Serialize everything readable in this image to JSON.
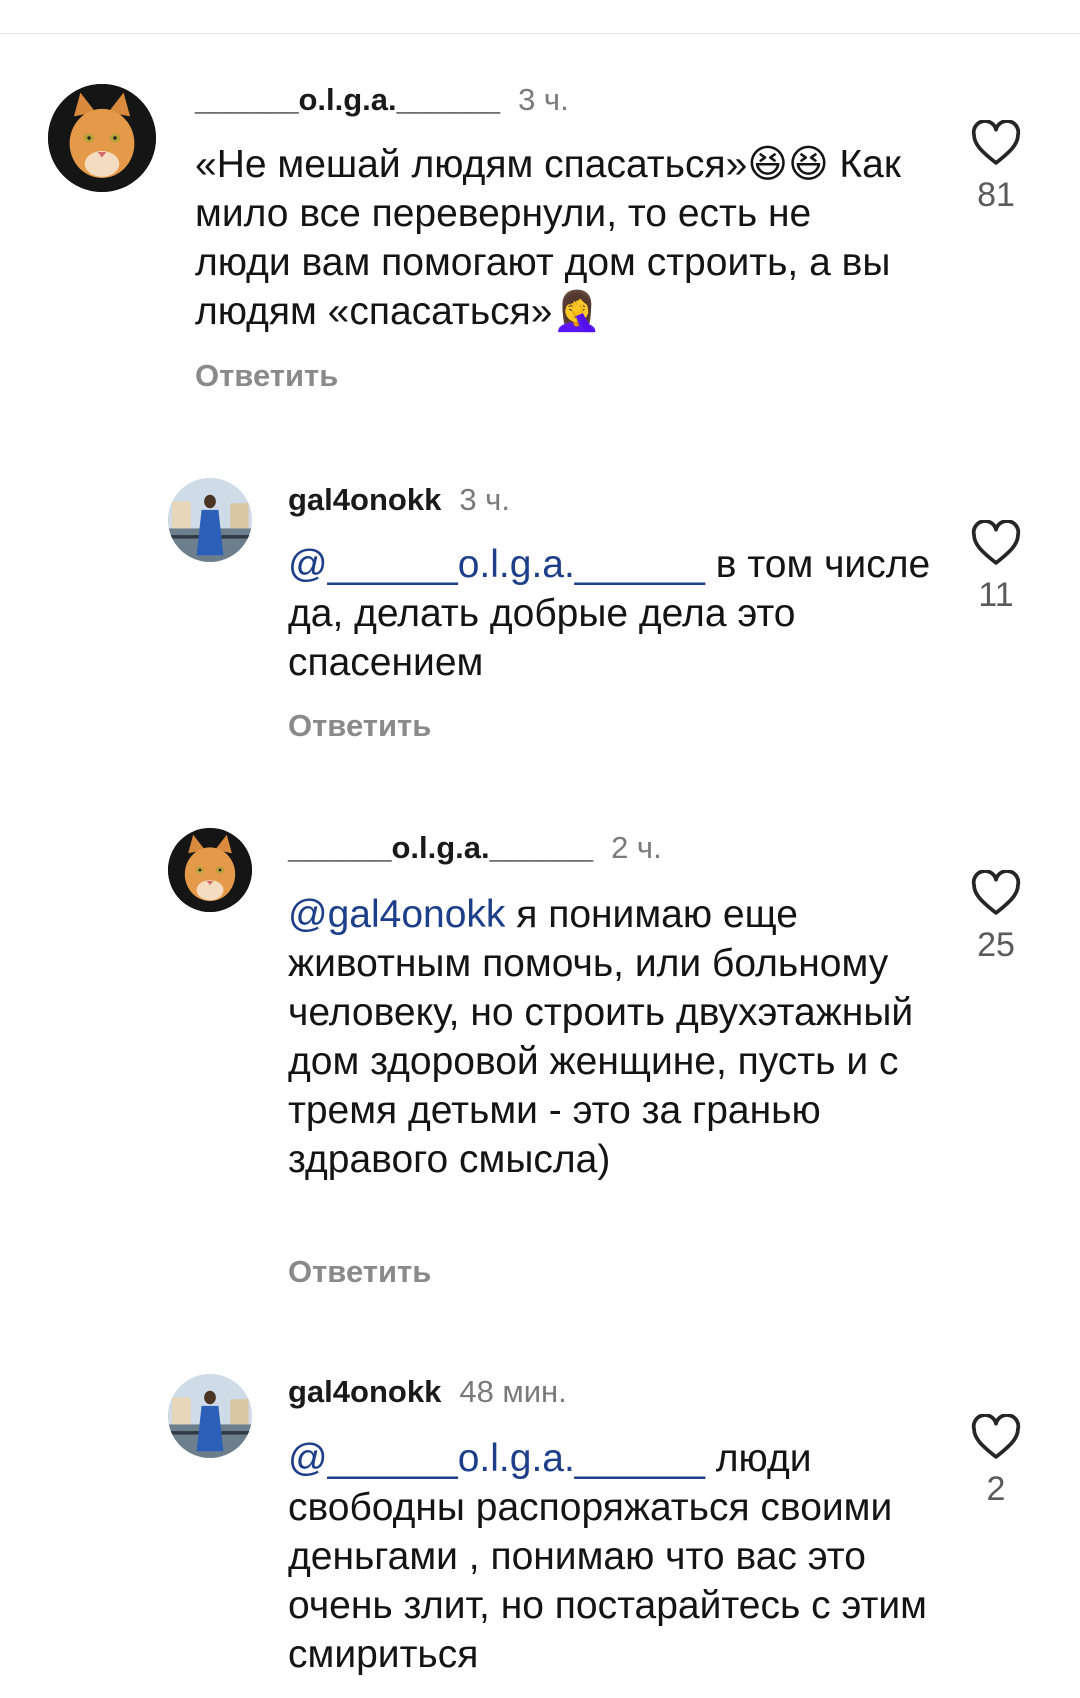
{
  "comments": [
    {
      "username": "______o.l.g.a.______",
      "time": "3 ч.",
      "text": "«Не мешай людям спасаться»😆😆 Как мило все перевернули, то есть не люди вам помогают дом строить, а вы людям «спасаться»🤦‍♀️",
      "reply_label": "Ответить",
      "likes": "81",
      "avatar": "cat-avatar"
    },
    {
      "username": "gal4onokk",
      "time": "3 ч.",
      "mention": "@______o.l.g.a.______",
      "text": " в том числе да, делать добрые дела это спасением",
      "reply_label": "Ответить",
      "likes": "11",
      "avatar": "woman-photo-avatar"
    },
    {
      "username": "______o.l.g.a.______",
      "time": "2 ч.",
      "mention": "@gal4onokk",
      "text": " я понимаю еще животным помочь, или больному человеку, но строить двухэтажный дом здоровой женщине, пусть и с тремя детьми - это за гранью здравого смысла)",
      "reply_label": "Ответить",
      "likes": "25",
      "avatar": "cat-avatar"
    },
    {
      "username": "gal4onokk",
      "time": "48 мин.",
      "mention": "@______o.l.g.a.______",
      "text": " люди свободны  распоряжаться своими деньгами , понимаю что вас это очень злит, но постарайтесь с этим смириться",
      "likes": "2",
      "avatar": "woman-photo-avatar"
    }
  ],
  "icons": {
    "like": "heart-outline-icon"
  },
  "colors": {
    "mention": "#1d3f8a",
    "secondary": "#8a8a8a"
  }
}
